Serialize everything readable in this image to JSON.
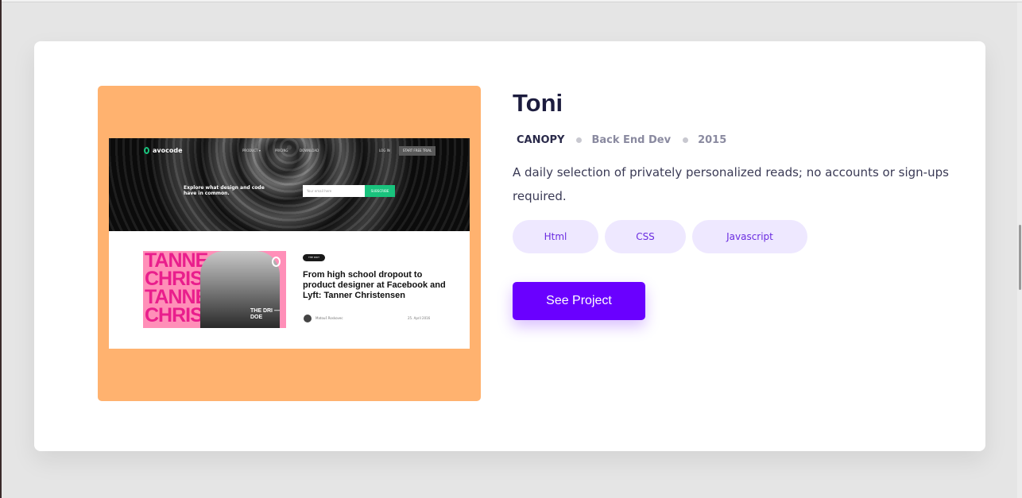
{
  "project": {
    "title": "Toni",
    "meta": {
      "company": "CANOPY",
      "role": "Back End Dev",
      "year": "2015"
    },
    "description": "A daily selection of privately personalized reads; no accounts or sign-ups required.",
    "tags": [
      "Html",
      "CSS",
      "Javascript"
    ],
    "cta_label": "See Project",
    "accent_color": "#6a00ff",
    "preview_bg_color": "#ffb26f"
  },
  "preview_screenshot": {
    "logo": "avocode",
    "nav": [
      "PRODUCT ▾",
      "PRICING",
      "DOWNLOAD",
      "LOG IN"
    ],
    "cta": "START FREE TRIAL",
    "hero_text": "Explore what design and code have in common.",
    "email_placeholder": "Your email here",
    "subscribe": "SUBSCRIBE",
    "feature_lines": [
      "TANNE",
      "CHRIS",
      "TANNE",
      "CHRIS"
    ],
    "feature_tag": "THE DRI — DOE",
    "chip": "THE DRIT",
    "article_title": "From high school dropout to product designer at Facebook and Lyft: Tanner Christensen",
    "author": "Matouš Roskovec",
    "date": "25. April 2016"
  }
}
